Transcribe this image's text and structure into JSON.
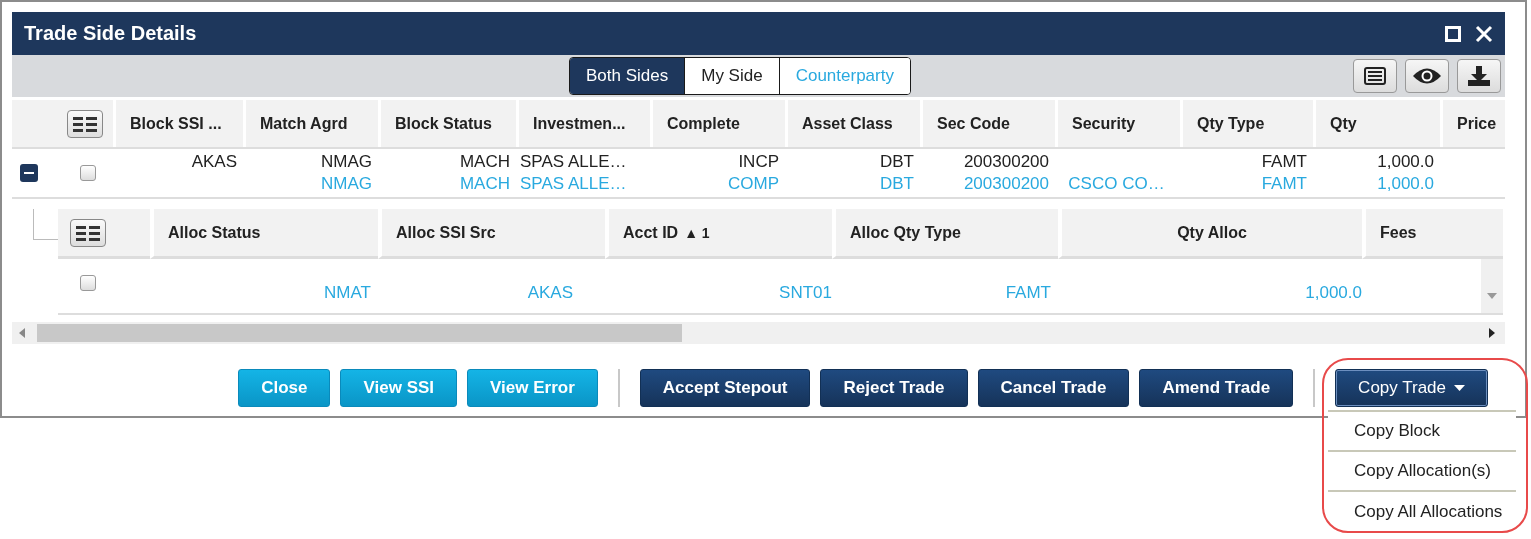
{
  "window": {
    "title": "Trade Side Details"
  },
  "tabs": [
    {
      "label": "Both Sides",
      "kind": "both",
      "selected": true
    },
    {
      "label": "My Side",
      "kind": "mine",
      "selected": false
    },
    {
      "label": "Counterparty",
      "kind": "counterparty",
      "selected": false
    }
  ],
  "block_table": {
    "columns": [
      "Block SSI ...",
      "Match Agrd",
      "Block Status",
      "Investmen...",
      "Complete",
      "Asset Class",
      "Sec Code",
      "Security",
      "Qty Type",
      "Qty",
      "Price"
    ],
    "rows": [
      {
        "expanded": true,
        "checked": false,
        "lines": [
          {
            "kind": "my_side",
            "cells": [
              "AKAS",
              "NMAG",
              "MACH",
              "SPAS  ALLE…",
              "INCP",
              "DBT",
              "200300200",
              null,
              "FAMT",
              "1,000.0",
              null
            ]
          },
          {
            "kind": "counterparty",
            "cells": [
              null,
              "NMAG",
              "MACH",
              "SPAS  ALLE…",
              "COMP",
              "DBT",
              "200300200",
              "CSCO CO…",
              "FAMT",
              "1,000.0",
              null
            ]
          }
        ]
      }
    ]
  },
  "allocation_table": {
    "columns": [
      {
        "label": "Alloc Status"
      },
      {
        "label": "Alloc SSI Src"
      },
      {
        "label": "Acct ID",
        "sort_mark": "▲ 1"
      },
      {
        "label": "Alloc Qty Type"
      },
      {
        "label": "Qty Alloc"
      },
      {
        "label": "Fees"
      }
    ],
    "rows": [
      {
        "checked": false,
        "cells": [
          "NMAT",
          "AKAS",
          "SNT01",
          "FAMT",
          "1,000.0",
          null
        ]
      }
    ]
  },
  "button_groups": [
    {
      "buttons": [
        {
          "label": "Close",
          "kind": "secondary"
        },
        {
          "label": "View SSI",
          "kind": "secondary"
        },
        {
          "label": "View Error",
          "kind": "secondary"
        }
      ]
    },
    {
      "buttons": [
        {
          "label": "Accept Stepout",
          "kind": "primary"
        },
        {
          "label": "Reject Trade",
          "kind": "primary"
        },
        {
          "label": "Cancel Trade",
          "kind": "primary"
        },
        {
          "label": "Amend Trade",
          "kind": "primary"
        }
      ]
    },
    {
      "buttons": [
        {
          "label": "Copy Trade",
          "kind": "dropdown",
          "expanded": true,
          "menu": [
            "Copy Block",
            "Copy Allocation(s)",
            "Copy All Allocations"
          ]
        }
      ]
    }
  ]
}
